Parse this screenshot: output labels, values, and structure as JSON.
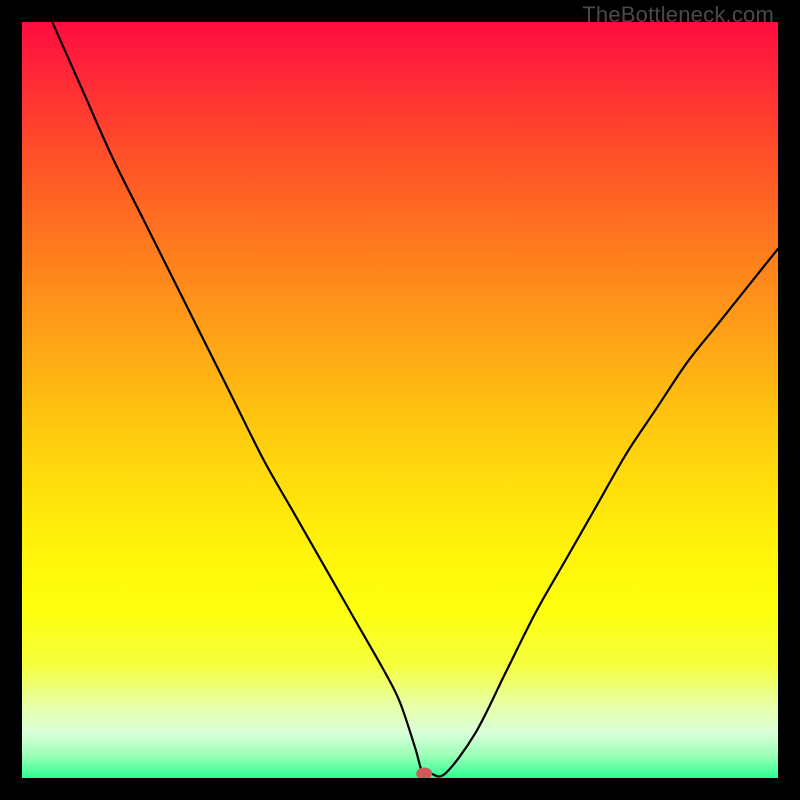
{
  "watermark": "TheBottleneck.com",
  "chart_data": {
    "type": "line",
    "title": "",
    "xlabel": "",
    "ylabel": "",
    "xlim": [
      0,
      100
    ],
    "ylim": [
      0,
      100
    ],
    "grid": false,
    "series": [
      {
        "name": "bottleneck-curve",
        "x": [
          4,
          8,
          12,
          16,
          20,
          24,
          28,
          32,
          36,
          40,
          44,
          48,
          50,
          52,
          53,
          54,
          56,
          60,
          64,
          68,
          72,
          76,
          80,
          84,
          88,
          92,
          96,
          100
        ],
        "y": [
          100,
          91,
          82,
          74,
          66,
          58,
          50,
          42,
          35,
          28,
          21,
          14,
          10,
          4,
          0.6,
          0.6,
          0.6,
          6,
          14,
          22,
          29,
          36,
          43,
          49,
          55,
          60,
          65,
          70
        ]
      }
    ],
    "marker": {
      "x": 53.2,
      "y": 0.6,
      "color": "#cf5a5a",
      "rx": 8,
      "ry": 6
    },
    "background_gradient": {
      "top": "#ff0c3f",
      "mid": "#fff40a",
      "bottom": "#2aff91"
    }
  }
}
